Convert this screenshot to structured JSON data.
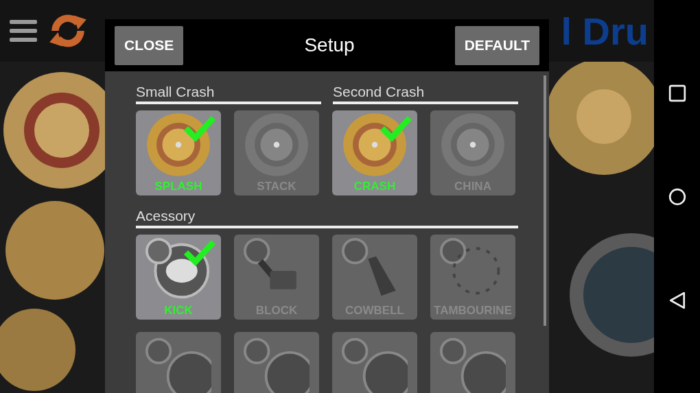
{
  "top_bar": {
    "logo": "l Dru"
  },
  "dialog": {
    "title": "Setup",
    "buttons": [
      {
        "label": "CLOSE"
      },
      {
        "label": "DEFAULT"
      }
    ],
    "groups": [
      {
        "headers": [
          "Small Crash",
          "Second Crash"
        ],
        "items": [
          {
            "label": "SPLASH",
            "kind": "cymbal",
            "selected": true
          },
          {
            "label": "STACK",
            "kind": "cymbal",
            "selected": false
          },
          {
            "label": "CRASH",
            "kind": "cymbal",
            "selected": true
          },
          {
            "label": "CHINA",
            "kind": "cymbal",
            "selected": false
          }
        ]
      },
      {
        "headers": [
          "Acessory"
        ],
        "items": [
          {
            "label": "KICK",
            "kind": "kick",
            "selected": true
          },
          {
            "label": "BLOCK",
            "kind": "block",
            "selected": false
          },
          {
            "label": "COWBELL",
            "kind": "cowbell",
            "selected": false
          },
          {
            "label": "TAMBOURINE",
            "kind": "tambourine",
            "selected": false
          }
        ]
      },
      {
        "items": [
          {
            "kind": "drum",
            "selected": false
          },
          {
            "kind": "drum",
            "selected": false
          },
          {
            "kind": "drum",
            "selected": false
          },
          {
            "kind": "drum",
            "selected": false
          }
        ]
      }
    ]
  }
}
